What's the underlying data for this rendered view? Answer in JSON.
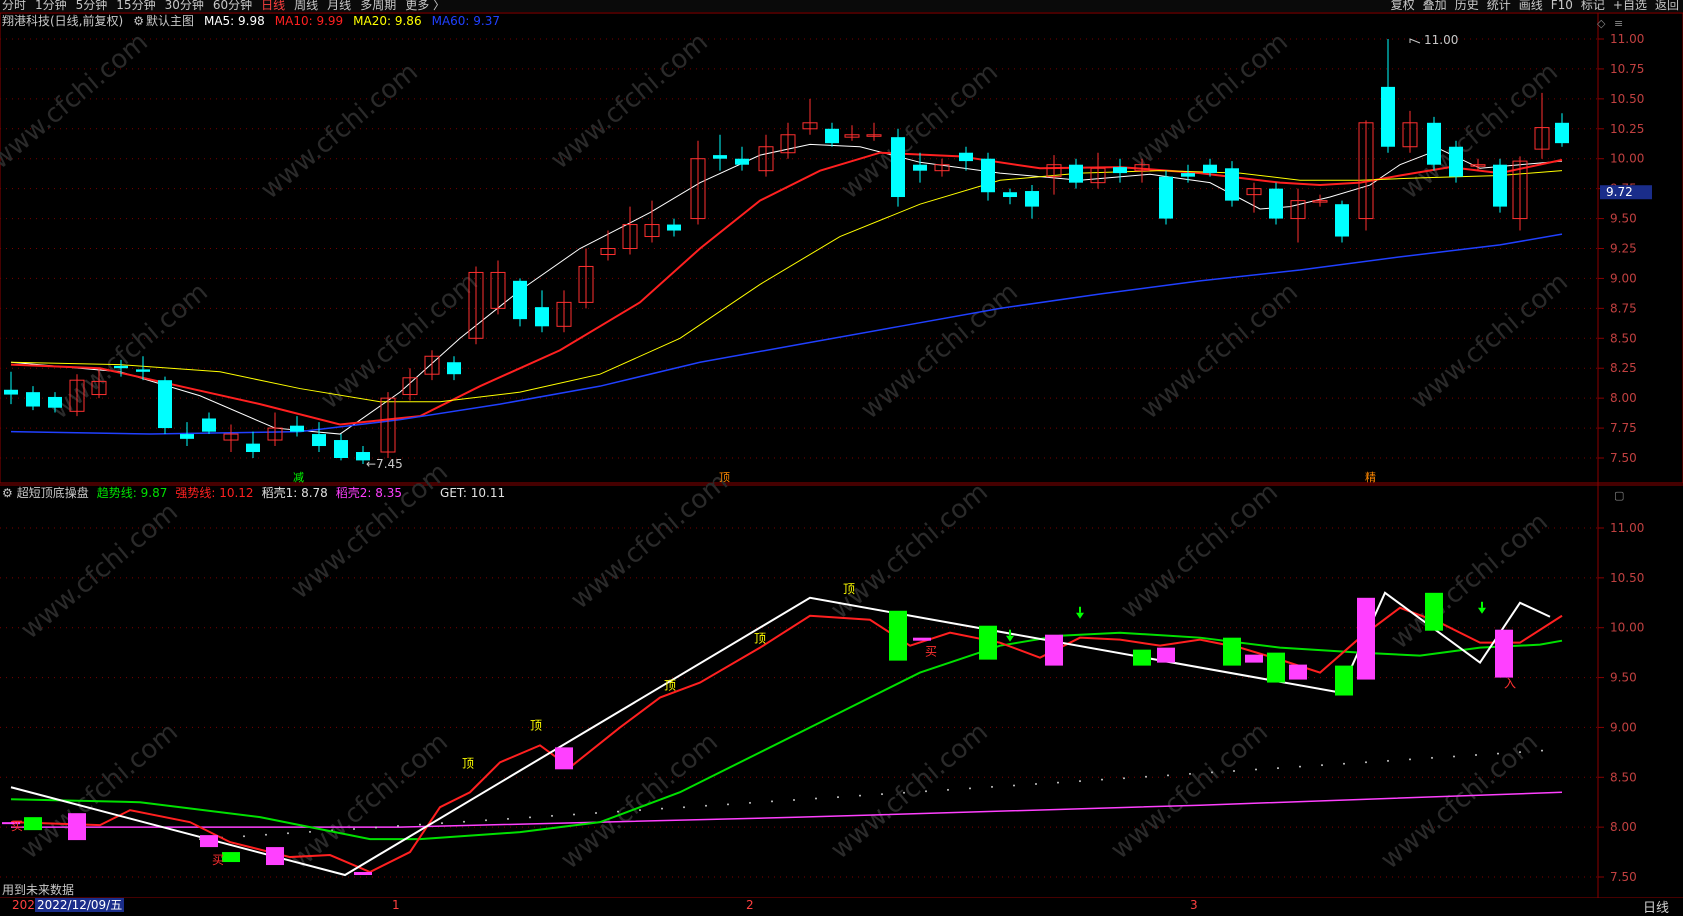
{
  "toolbar": {
    "periods": [
      "分时",
      "1分钟",
      "5分钟",
      "15分钟",
      "30分钟",
      "60分钟",
      "日线",
      "周线",
      "月线",
      "多周期",
      "更多 〉"
    ],
    "active": "日线",
    "right_items": [
      "复权",
      "叠加",
      "历史",
      "统计",
      "画线",
      "F10",
      "标记",
      "+自选",
      "返回"
    ]
  },
  "main_panel": {
    "title": "翔港科技(日线,前复权)",
    "indicator_name": "默认主图",
    "ma": [
      {
        "label": "MA5: 9.98",
        "color": "#ffffff"
      },
      {
        "label": "MA10: 9.99",
        "color": "#ff2020"
      },
      {
        "label": "MA20: 9.86",
        "color": "#ffff00"
      },
      {
        "label": "MA60: 9.37",
        "color": "#2040ff"
      }
    ],
    "price_ticks": [
      "11.00",
      "10.75",
      "10.50",
      "10.25",
      "10.00",
      "9.75",
      "9.50",
      "9.25",
      "9.00",
      "8.75",
      "8.50",
      "8.25",
      "8.00",
      "7.75",
      "7.50"
    ],
    "current_price": "9.72",
    "high_label": "11.00",
    "low_label": "7.45",
    "markers": [
      "减",
      "顶",
      "精"
    ]
  },
  "sub_panel": {
    "name": "超短顶底操盘",
    "fields": [
      {
        "label": "趋势线: 9.87",
        "color": "#00e000"
      },
      {
        "label": "强势线: 10.12",
        "color": "#ff2020"
      },
      {
        "label": "稻壳1: 8.78",
        "color": "#e0e0e0"
      },
      {
        "label": "稻壳2: 8.35",
        "color": "#ff40ff"
      },
      {
        "label": "GET: 10.11",
        "color": "#e0e0e0"
      }
    ],
    "ticks": [
      "11.00",
      "10.50",
      "10.00",
      "9.50",
      "9.00",
      "8.50",
      "8.00",
      "7.50"
    ],
    "top_labels": [
      "顶",
      "顶",
      "顶",
      "顶",
      "顶"
    ],
    "buy_labels": [
      "买",
      "买",
      "买"
    ],
    "in_label": "入",
    "note": "用到未来数据"
  },
  "bottom": {
    "date": "2022/12/09/五",
    "year_prefix": "202",
    "month_marks": [
      "1",
      "2",
      "3"
    ],
    "period": "日线"
  }
}
